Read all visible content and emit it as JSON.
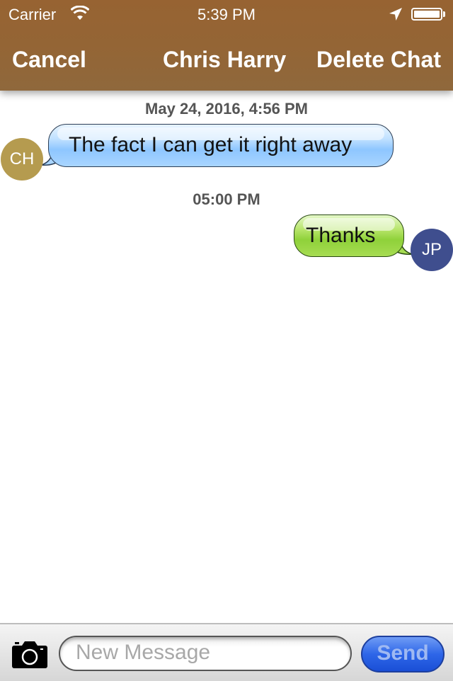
{
  "status_bar": {
    "carrier": "Carrier",
    "time": "5:39 PM",
    "icons": [
      "wifi-icon",
      "location-arrow-icon",
      "battery-icon"
    ]
  },
  "nav": {
    "cancel_label": "Cancel",
    "title": "Chris Harry",
    "delete_label": "Delete Chat"
  },
  "colors": {
    "header": "#976332",
    "incoming_avatar": "#b59b4f",
    "outgoing_avatar": "#3f4e8e",
    "incoming_bubble": "#9ccdff",
    "outgoing_bubble": "#9bd748",
    "send_button": "#2e66e8"
  },
  "messages": [
    {
      "timestamp": "May 24, 2016, 4:56 PM",
      "direction": "incoming",
      "avatar_initials": "CH",
      "text": "The fact I can get it right away"
    },
    {
      "timestamp": "05:00 PM",
      "direction": "outgoing",
      "avatar_initials": "JP",
      "text": "Thanks"
    }
  ],
  "composer": {
    "camera_icon": "camera-icon",
    "input_value": "",
    "input_placeholder": "New Message",
    "send_label": "Send"
  }
}
